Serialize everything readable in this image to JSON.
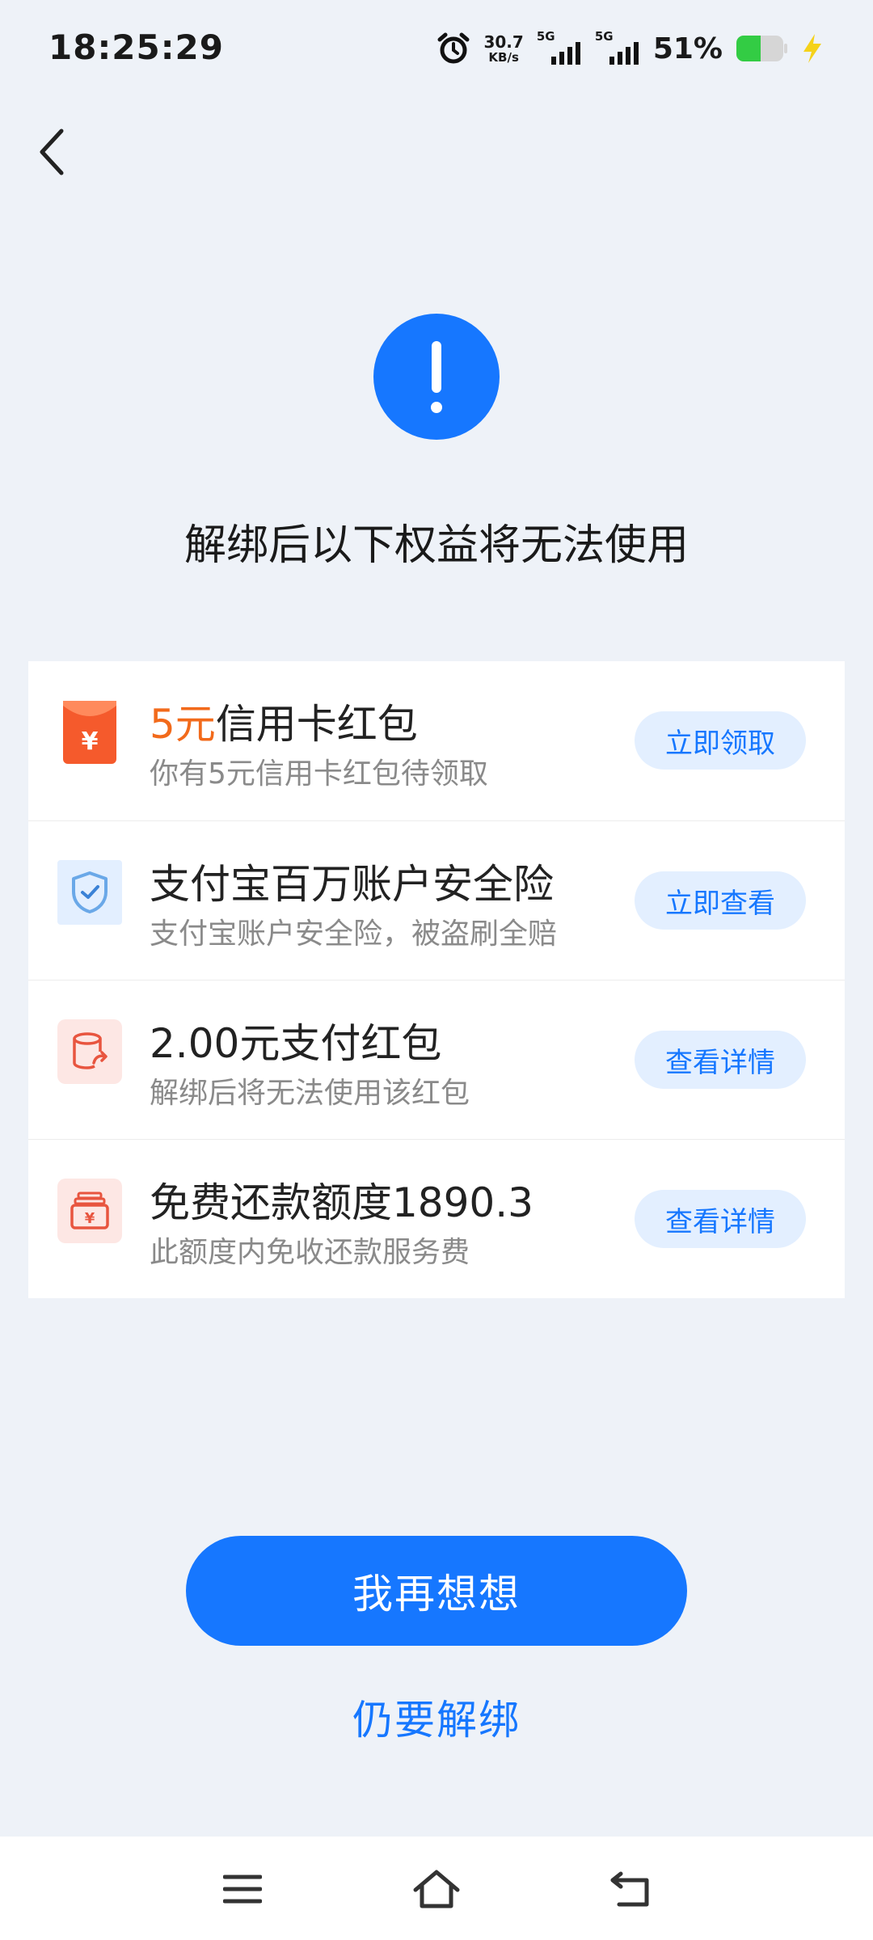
{
  "status_bar": {
    "time": "18:25:29",
    "net_speed_value": "30.7",
    "net_speed_unit": "KB/s",
    "sim1_tag": "5G",
    "sim2_tag": "5G",
    "battery_percent": "51%"
  },
  "headline": "解绑后以下权益将无法使用",
  "benefits": [
    {
      "title_highlight": "5元",
      "title": "信用卡红包",
      "subtitle": "你有5元信用卡红包待领取",
      "button": "立即领取"
    },
    {
      "title_highlight": "",
      "title": "支付宝百万账户安全险",
      "subtitle": "支付宝账户安全险，被盗刷全赔",
      "button": "立即查看"
    },
    {
      "title_highlight": "",
      "title": "2.00元支付红包",
      "subtitle": "解绑后将无法使用该红包",
      "button": "查看详情"
    },
    {
      "title_highlight": "",
      "title": "免费还款额度1890.3",
      "subtitle": "此额度内免收还款服务费",
      "button": "查看详情"
    }
  ],
  "primary_button": "我再想想",
  "secondary_link": "仍要解绑",
  "colors": {
    "accent": "#1677ff",
    "highlight": "#f26a1b",
    "background": "#eef2f8"
  },
  "icons": {
    "back": "back-arrow-icon",
    "alert": "exclamation-icon",
    "benefit_1": "red-envelope-yuan-icon",
    "benefit_2": "shield-check-icon",
    "benefit_3": "wallet-red-envelope-icon",
    "benefit_4": "repayment-yuan-icon"
  }
}
